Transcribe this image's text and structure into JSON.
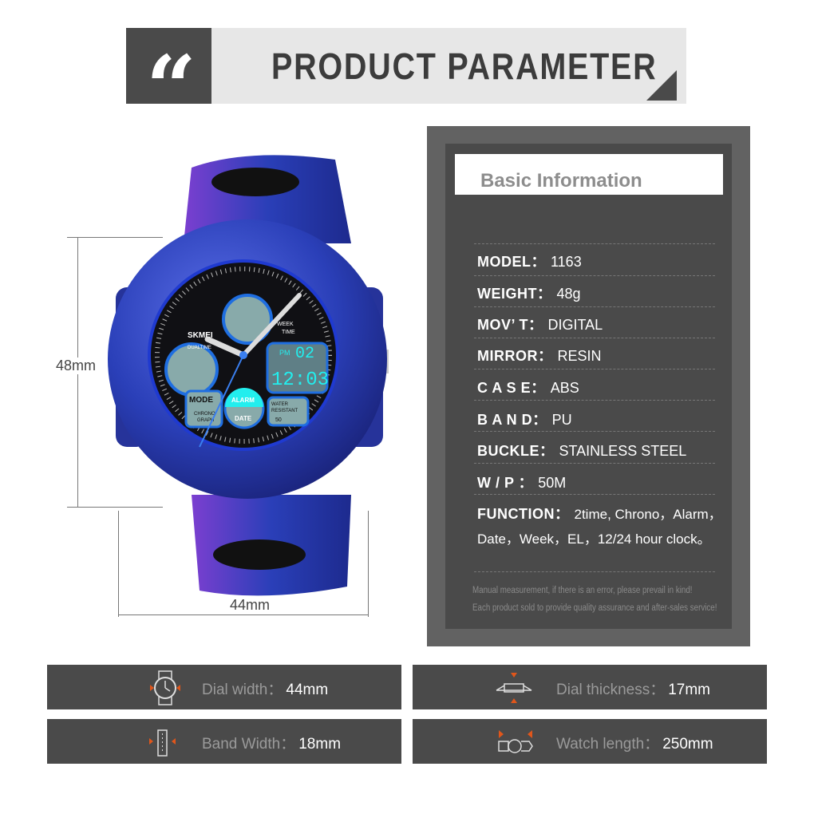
{
  "header": {
    "quote_mark": "“",
    "title": "PRODUCT PARAMETER"
  },
  "panel": {
    "heading": "Basic Information",
    "specs": [
      {
        "label": "MODEL：",
        "value": "1163"
      },
      {
        "label": "WEIGHT：",
        "value": "48g"
      },
      {
        "label": "MOV’ T：",
        "value": "DIGITAL"
      },
      {
        "label": "MIRROR：",
        "value": "RESIN"
      },
      {
        "label": "C A S E：",
        "value": "ABS"
      },
      {
        "label": "B A N D：",
        "value": "PU"
      },
      {
        "label": "BUCKLE：",
        "value": "STAINLESS STEEL"
      },
      {
        "label": "W / P ：",
        "value": "50M"
      },
      {
        "label": "FUNCTION：",
        "value": "2time, Chrono，Alarm，",
        "value2": "Date，Week，EL，12/24 hour clock。"
      }
    ],
    "notes": [
      "Manual measurement, if there is an error, please prevail in kind!",
      "Each product sold to provide quality assurance and after-sales service!"
    ]
  },
  "dimensions": {
    "height": "48mm",
    "width": "44mm"
  },
  "watch_face": {
    "brand": "SKMEI",
    "dualtime": "DUALTIME",
    "mode": "MODE",
    "chrono": "CHRONO",
    "graph": "GRAPH",
    "alarm": "ALARM",
    "date": "DATE",
    "water": "WATER",
    "resistant": "RESISTANT",
    "wr_value": "50",
    "pm": "PM",
    "lcd_top": "02",
    "lcd_time": "12:03",
    "week": "WEEK",
    "time": "TIME"
  },
  "measurements": [
    {
      "label": "Dial width：",
      "value": "44mm",
      "icon": "watch-face-icon"
    },
    {
      "label": "Dial thickness：",
      "value": "17mm",
      "icon": "watch-side-icon"
    },
    {
      "label": "Band Width：",
      "value": "18mm",
      "icon": "band-icon"
    },
    {
      "label": "Watch length：",
      "value": "250mm",
      "icon": "watch-length-icon"
    }
  ],
  "colors": {
    "accent": "#e0561b",
    "panel": "#4a4a4a",
    "watch_blue": "#2a3fb8"
  }
}
